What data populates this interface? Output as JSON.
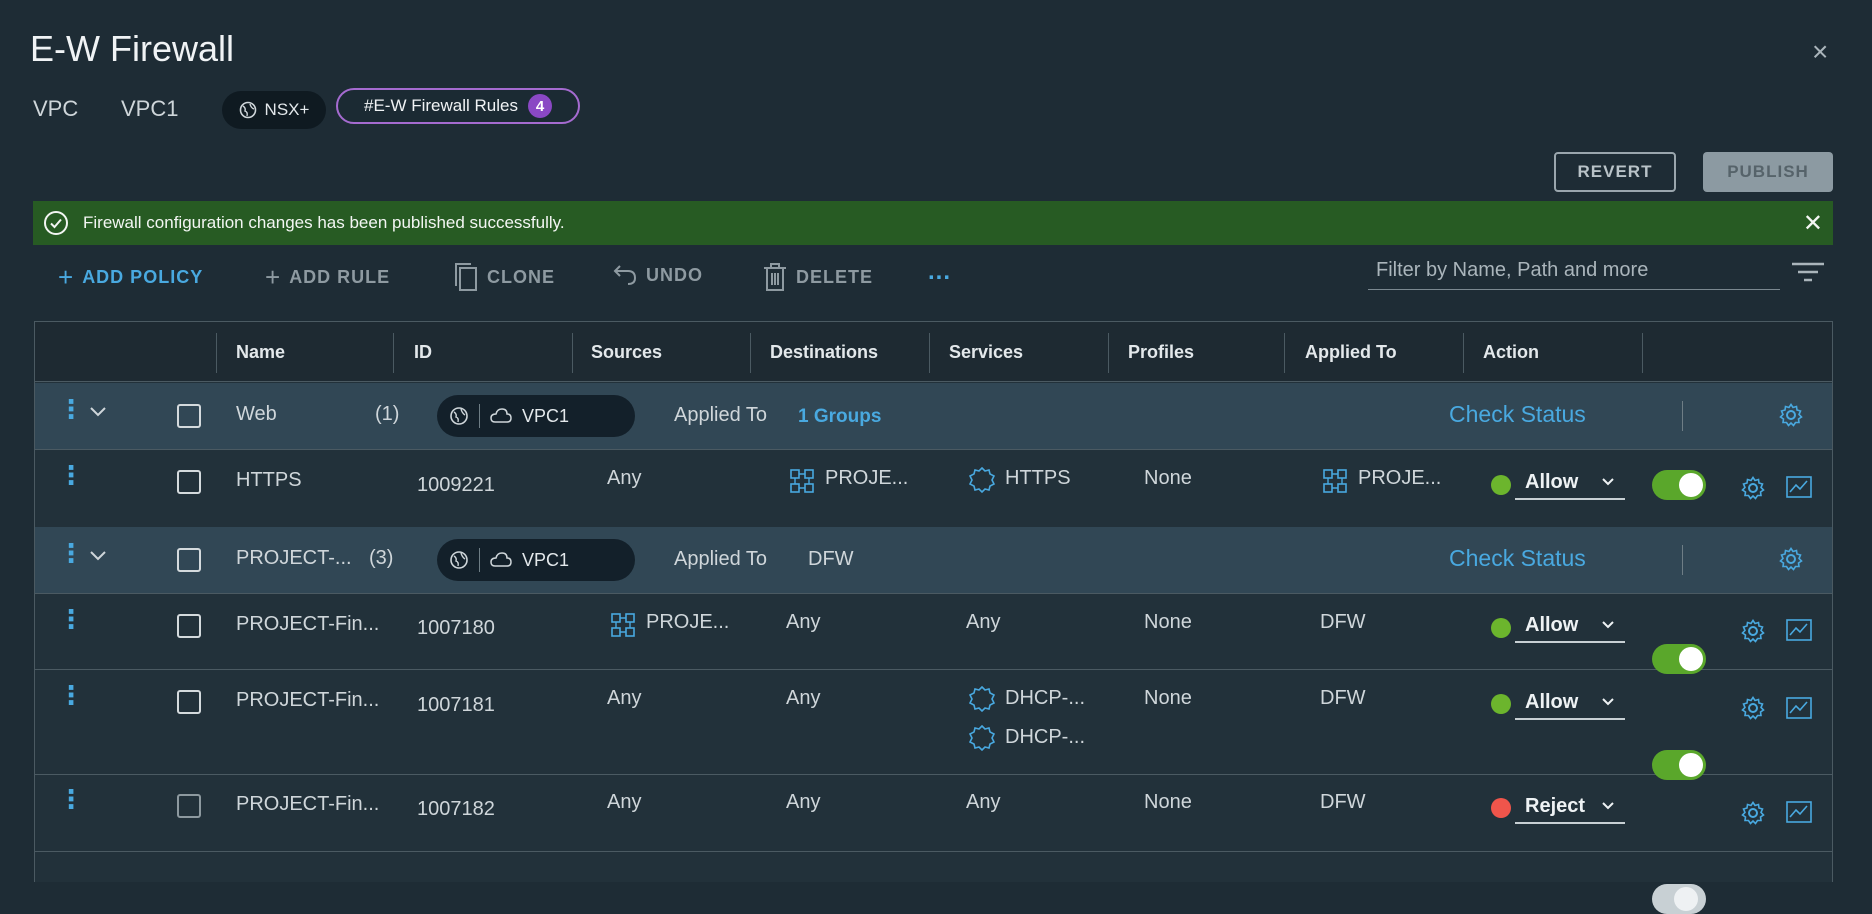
{
  "window": {
    "title": "E-W Firewall",
    "close_label": "×"
  },
  "breadcrumb": {
    "vpc_label": "VPC",
    "vpc_name": "VPC1",
    "nsx_label": "NSX+",
    "rules_label": "#E-W Firewall Rules",
    "rules_count": "4"
  },
  "actions": {
    "revert": "REVERT",
    "publish": "PUBLISH"
  },
  "alert": {
    "message": "Firewall configuration changes has been published successfully.",
    "close_label": "✕"
  },
  "toolbar": {
    "add_policy": "ADD POLICY",
    "add_rule": "ADD RULE",
    "clone": "CLONE",
    "undo": "UNDO",
    "delete": "DELETE",
    "more": "...",
    "filter_placeholder": "Filter by Name, Path and more"
  },
  "table": {
    "columns": [
      "Name",
      "ID",
      "Sources",
      "Destinations",
      "Services",
      "Profiles",
      "Applied To",
      "Action"
    ],
    "policies": [
      {
        "name": "Web",
        "count": "(1)",
        "scope": "VPC1",
        "applied_to_label": "Applied To",
        "applied_to_value": "1 Groups",
        "check_status": "Check Status",
        "rules": [
          {
            "name": "HTTPS",
            "id": "1009221",
            "sources": "Any",
            "destinations": "PROJE...",
            "services": [
              "HTTPS"
            ],
            "profiles": "None",
            "applied_to": "PROJE...",
            "action": "Allow",
            "enabled": true
          }
        ]
      },
      {
        "name": "PROJECT-...",
        "count": "(3)",
        "scope": "VPC1",
        "applied_to_label": "Applied To",
        "applied_to_value": "DFW",
        "check_status": "Check Status",
        "rules": [
          {
            "name": "PROJECT-Fin...",
            "id": "1007180",
            "sources": "PROJE...",
            "destinations": "Any",
            "services": [
              "Any"
            ],
            "profiles": "None",
            "applied_to": "DFW",
            "action": "Allow",
            "enabled": true
          },
          {
            "name": "PROJECT-Fin...",
            "id": "1007181",
            "sources": "Any",
            "destinations": "Any",
            "services": [
              "DHCP-...",
              "DHCP-..."
            ],
            "profiles": "None",
            "applied_to": "DFW",
            "action": "Allow",
            "enabled": true
          },
          {
            "name": "PROJECT-Fin...",
            "id": "1007182",
            "sources": "Any",
            "destinations": "Any",
            "services": [
              "Any"
            ],
            "profiles": "None",
            "applied_to": "DFW",
            "action": "Reject",
            "enabled": false
          }
        ]
      }
    ]
  },
  "colors": {
    "accent": "#49a9e0",
    "success_bar": "#275b23",
    "allow": "#6cb52d",
    "reject": "#f0554b",
    "badge": "#8a48c4"
  }
}
